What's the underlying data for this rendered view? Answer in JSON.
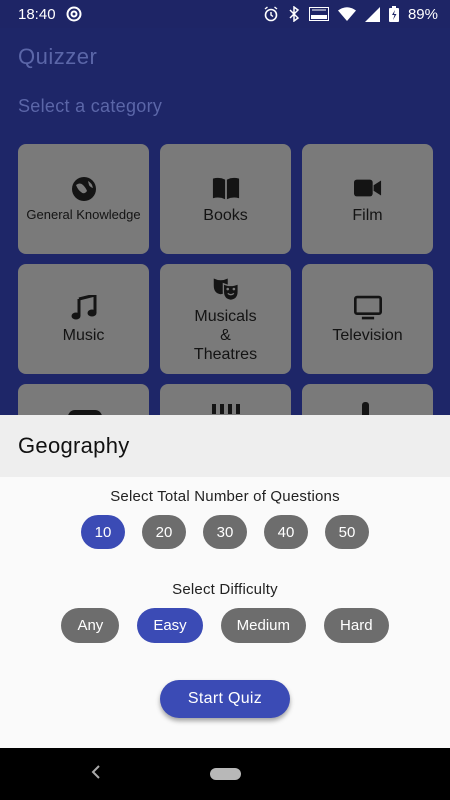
{
  "status_bar": {
    "time": "18:40",
    "battery_percent": "89%",
    "icons": [
      "at-sign-icon",
      "alarm-icon",
      "bluetooth-icon",
      "volte-icon",
      "wifi-icon",
      "signal-icon",
      "battery-icon"
    ]
  },
  "app": {
    "title": "Quizzer",
    "subtitle": "Select a category"
  },
  "categories": [
    {
      "label": "General Knowledge",
      "icon": "globe-icon"
    },
    {
      "label": "Books",
      "icon": "book-icon"
    },
    {
      "label": "Film",
      "icon": "video-camera-icon"
    },
    {
      "label": "Music",
      "icon": "music-note-icon"
    },
    {
      "label": "Musicals & Theatres",
      "icon": "theater-masks-icon"
    },
    {
      "label": "Television",
      "icon": "tv-icon"
    }
  ],
  "sheet": {
    "title": "Geography",
    "questions_label": "Select Total Number of Questions",
    "question_options": [
      "10",
      "20",
      "30",
      "40",
      "50"
    ],
    "selected_questions": "10",
    "difficulty_label": "Select Difficulty",
    "difficulty_options": [
      "Any",
      "Easy",
      "Medium",
      "Hard"
    ],
    "selected_difficulty": "Easy",
    "start_label": "Start Quiz"
  },
  "colors": {
    "app_background": "#1e2668",
    "card": "#7a7a7a",
    "accent": "#3b4bb5",
    "pill_inactive": "#6d6d6d"
  }
}
